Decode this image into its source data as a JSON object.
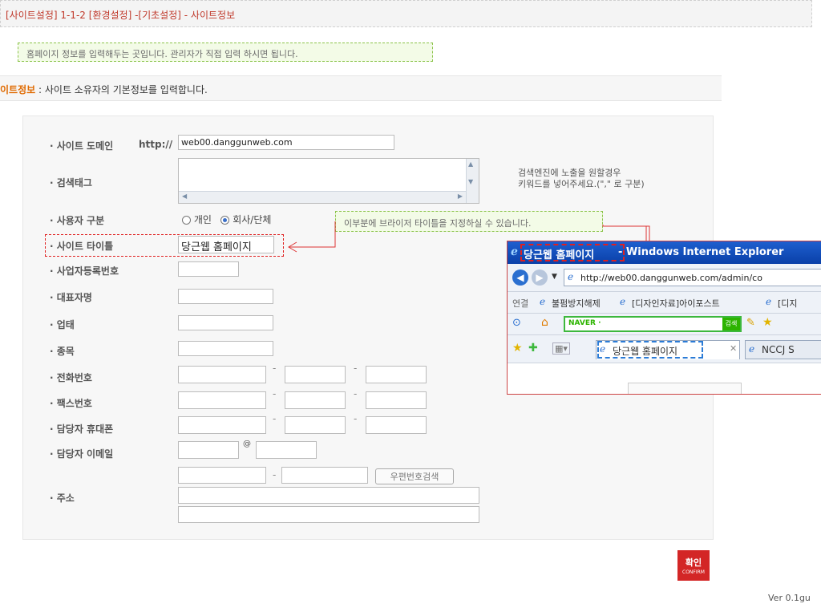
{
  "breadcrumb": "[사이트설정] 1-1-2 [환경설정] -[기초설정] - 사이트정보",
  "top_tip": "홈페이지 정보를 입력해두는 곳입니다. 관리자가 직접 입력 하시면 됩니다.",
  "info_heading": "이트정보",
  "info_text": ": 사이트 소유자의 기본정보를 입력합니다.",
  "form": {
    "domain_label": "· 사이트 도메인",
    "domain_prefix": "http://",
    "domain_value": "web00.danggunweb.com",
    "tags_label": "· 검색태그",
    "tags_help": "검색엔진에 노출을 원할경우\n키워드를 넣어주세요.(\",\" 로 구분)",
    "usertype_label": "· 사용자 구분",
    "usertype_options": [
      "개인",
      "회사/단체"
    ],
    "usertype_selected": "회사/단체",
    "title_label": "· 사이트 타이틀",
    "title_value": "당근웹 홈페이지",
    "bizno_label": "· 사업자등록번호",
    "ceo_label": "· 대표자명",
    "bizcat_label": "· 업태",
    "bizitem_label": "· 종목",
    "phone_label": "· 전화번호",
    "fax_label": "· 팩스번호",
    "mobile_label": "· 담당자 휴대폰",
    "email_label": "· 담당자 이메일",
    "email_at": "@",
    "address_label": "· 주소",
    "zip_button": "우편번호검색",
    "dash": "-"
  },
  "callout": "이부분에 브라이저 타이틀을 지정하실 수 있습니다.",
  "ie": {
    "title_part1": "당근웹 홈페이지",
    "title_part2": "- Windows Internet Explorer",
    "address": "http://web00.danggunweb.com/admin/co",
    "links_label": "연결",
    "link1": "불펌방지해제",
    "link2": "[디자인자료]아이포스트",
    "link3": "[디지",
    "naver": "NAVER ·",
    "search_btn": "검색",
    "tab1": "당근웹 홈페이지",
    "tab2": "NCCJ S"
  },
  "confirm": {
    "label": "확인",
    "sub": "CONFIRM"
  },
  "version": "Ver 0.1gu",
  "colors": {
    "accent_red": "#d32626",
    "tip_green": "#8bc34a",
    "ie_blue": "#0a40a8"
  }
}
